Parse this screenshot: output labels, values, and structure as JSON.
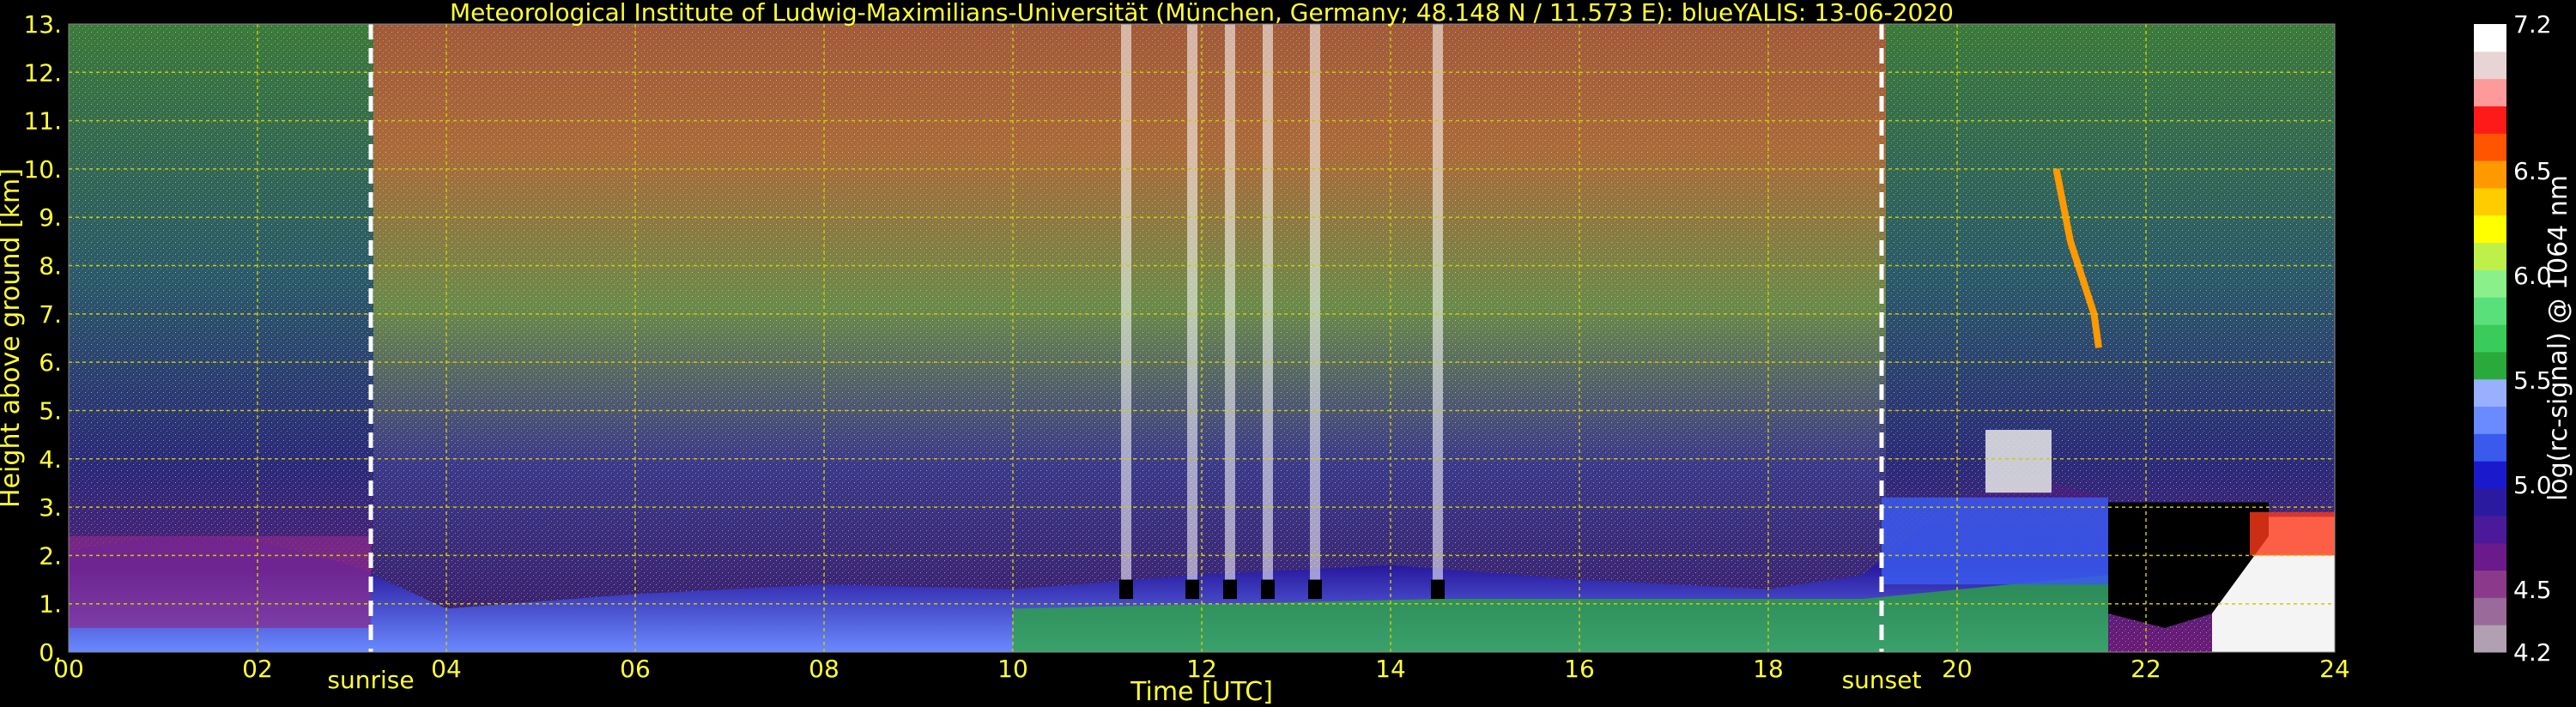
{
  "chart_data": {
    "type": "heatmap",
    "title": "Meteorological Institute of Ludwig-Maximilians-Universität (München, Germany; 48.148 N / 11.573 E):    blueYALIS: 13-06-2020",
    "xlabel": "Time [UTC]",
    "ylabel": "Height above ground [km]",
    "xlim": [
      0,
      24
    ],
    "ylim": [
      0,
      13
    ],
    "x_ticks": [
      "00",
      "02",
      "04",
      "06",
      "08",
      "10",
      "12",
      "14",
      "16",
      "18",
      "20",
      "22",
      "24"
    ],
    "y_ticks": [
      "0.",
      "1.",
      "2.",
      "3.",
      "4.",
      "5.",
      "6.",
      "7.",
      "8.",
      "9.",
      "10.",
      "11.",
      "12.",
      "13."
    ],
    "grid": true,
    "events": [
      {
        "label": "sunrise",
        "time_utc": 3.2
      },
      {
        "label": "sunset",
        "time_utc": 19.2
      }
    ],
    "colorbar": {
      "label": "log(rc-signal) @ 1064 nm",
      "range": [
        4.2,
        7.2
      ],
      "tick_labels": [
        "4.2",
        "4.5",
        "5.0",
        "5.5",
        "6.0",
        "6.5",
        "7.2"
      ],
      "colors": [
        "#b0a0b0",
        "#9a6a9a",
        "#8b3a8b",
        "#6a1a8a",
        "#4a1a9a",
        "#2a1aa0",
        "#1a1acc",
        "#3a5aee",
        "#6a8aff",
        "#98b0ff",
        "#2aaa3a",
        "#3acc5a",
        "#5ae07a",
        "#8af08a",
        "#bff04a",
        "#ffff00",
        "#ffcc00",
        "#ff9900",
        "#ff5500",
        "#ff1a1a",
        "#ff9a9a",
        "#e8d4d4",
        "#ffffff"
      ]
    },
    "boundary_layer_top_km": [
      {
        "t": 0,
        "h": 2.1
      },
      {
        "t": 1,
        "h": 2.4
      },
      {
        "t": 2,
        "h": 2.3
      },
      {
        "t": 3,
        "h": 1.8
      },
      {
        "t": 4,
        "h": 0.9
      },
      {
        "t": 6,
        "h": 1.2
      },
      {
        "t": 8,
        "h": 1.4
      },
      {
        "t": 10,
        "h": 1.3
      },
      {
        "t": 12,
        "h": 1.6
      },
      {
        "t": 14,
        "h": 1.8
      },
      {
        "t": 16,
        "h": 1.5
      },
      {
        "t": 18,
        "h": 1.3
      },
      {
        "t": 19,
        "h": 1.6
      },
      {
        "t": 20,
        "h": 3.2
      },
      {
        "t": 21,
        "h": 3.5
      },
      {
        "t": 21.6,
        "h": 3.2
      }
    ],
    "cloud_columns_utc": [
      11.2,
      11.9,
      12.3,
      12.7,
      13.2,
      14.5
    ]
  }
}
